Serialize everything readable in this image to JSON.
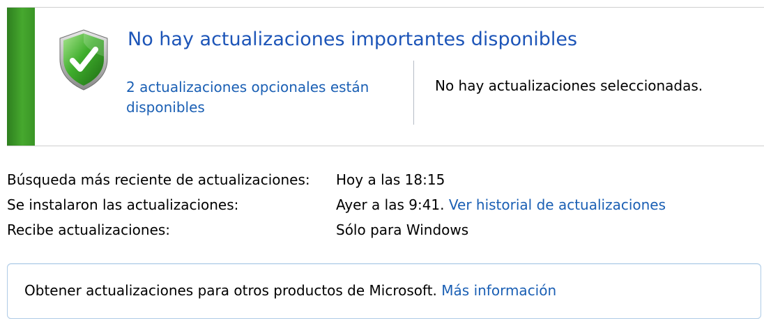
{
  "status": {
    "title": "No hay actualizaciones importantes disponibles",
    "optional_link": "2 actualizaciones opcionales están disponibles",
    "selected_info": "No hay actualizaciones seleccionadas.",
    "stripe_color": "#3a9526",
    "shield_icon": "shield-check-icon"
  },
  "info": {
    "rows": [
      {
        "label": "Búsqueda más reciente de actualizaciones:",
        "value": "Hoy a las 18:15",
        "link": ""
      },
      {
        "label": "Se instalaron las actualizaciones:",
        "value": "Ayer a las 9:41.",
        "link": "Ver historial de actualizaciones"
      },
      {
        "label": "Recibe actualizaciones:",
        "value": "Sólo para Windows",
        "link": ""
      }
    ]
  },
  "microsoft": {
    "text": "Obtener actualizaciones para otros productos de Microsoft.",
    "link": "Más información"
  },
  "colors": {
    "title_blue": "#1d55b8",
    "link_blue": "#1a5fb4",
    "success_green": "#3a9526"
  }
}
